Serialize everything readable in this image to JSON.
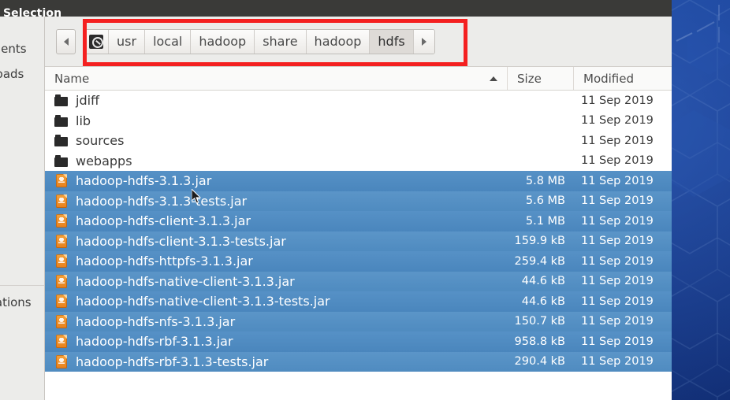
{
  "window": {
    "title": "Selection"
  },
  "sidebar": {
    "items": [
      {
        "label": "Documents"
      },
      {
        "label": "Downloads"
      },
      {
        "label": "Applications"
      }
    ]
  },
  "pathbar": {
    "back_icon": "triangle-left-icon",
    "forward_icon": "triangle-right-icon",
    "home_icon": "home-location-icon",
    "crumbs": [
      {
        "label": "usr",
        "current": false
      },
      {
        "label": "local",
        "current": false
      },
      {
        "label": "hadoop",
        "current": false
      },
      {
        "label": "share",
        "current": false
      },
      {
        "label": "hadoop",
        "current": false
      },
      {
        "label": "hdfs",
        "current": true
      }
    ]
  },
  "columns": {
    "name": "Name",
    "size": "Size",
    "modified": "Modified",
    "sort_icon": "sort-ascending-icon"
  },
  "files": [
    {
      "icon": "folder-icon",
      "name": "jdiff",
      "size": "",
      "modified": "11 Sep 2019",
      "selected": false
    },
    {
      "icon": "folder-icon",
      "name": "lib",
      "size": "",
      "modified": "11 Sep 2019",
      "selected": false
    },
    {
      "icon": "folder-icon",
      "name": "sources",
      "size": "",
      "modified": "11 Sep 2019",
      "selected": false
    },
    {
      "icon": "folder-icon",
      "name": "webapps",
      "size": "",
      "modified": "11 Sep 2019",
      "selected": false
    },
    {
      "icon": "jar-file-icon",
      "name": "hadoop-hdfs-3.1.3.jar",
      "size": "5.8 MB",
      "modified": "11 Sep 2019",
      "selected": true
    },
    {
      "icon": "jar-file-icon",
      "name": "hadoop-hdfs-3.1.3-tests.jar",
      "size": "5.6 MB",
      "modified": "11 Sep 2019",
      "selected": true
    },
    {
      "icon": "jar-file-icon",
      "name": "hadoop-hdfs-client-3.1.3.jar",
      "size": "5.1 MB",
      "modified": "11 Sep 2019",
      "selected": true
    },
    {
      "icon": "jar-file-icon",
      "name": "hadoop-hdfs-client-3.1.3-tests.jar",
      "size": "159.9 kB",
      "modified": "11 Sep 2019",
      "selected": true
    },
    {
      "icon": "jar-file-icon",
      "name": "hadoop-hdfs-httpfs-3.1.3.jar",
      "size": "259.4 kB",
      "modified": "11 Sep 2019",
      "selected": true
    },
    {
      "icon": "jar-file-icon",
      "name": "hadoop-hdfs-native-client-3.1.3.jar",
      "size": "44.6 kB",
      "modified": "11 Sep 2019",
      "selected": true
    },
    {
      "icon": "jar-file-icon",
      "name": "hadoop-hdfs-native-client-3.1.3-tests.jar",
      "size": "44.6 kB",
      "modified": "11 Sep 2019",
      "selected": true
    },
    {
      "icon": "jar-file-icon",
      "name": "hadoop-hdfs-nfs-3.1.3.jar",
      "size": "150.7 kB",
      "modified": "11 Sep 2019",
      "selected": true
    },
    {
      "icon": "jar-file-icon",
      "name": "hadoop-hdfs-rbf-3.1.3.jar",
      "size": "958.8 kB",
      "modified": "11 Sep 2019",
      "selected": true
    },
    {
      "icon": "jar-file-icon",
      "name": "hadoop-hdfs-rbf-3.1.3-tests.jar",
      "size": "290.4 kB",
      "modified": "11 Sep 2019",
      "selected": true
    }
  ],
  "annotation": {
    "shape": "rectangle-highlight",
    "color": "#f42020",
    "target": "pathbar-breadcrumbs"
  },
  "colors": {
    "selection": "#4a86bd",
    "titlebar": "#3a3a38",
    "sidebar": "#ececea",
    "desktop": "#14378c",
    "annotation": "#f42020"
  }
}
